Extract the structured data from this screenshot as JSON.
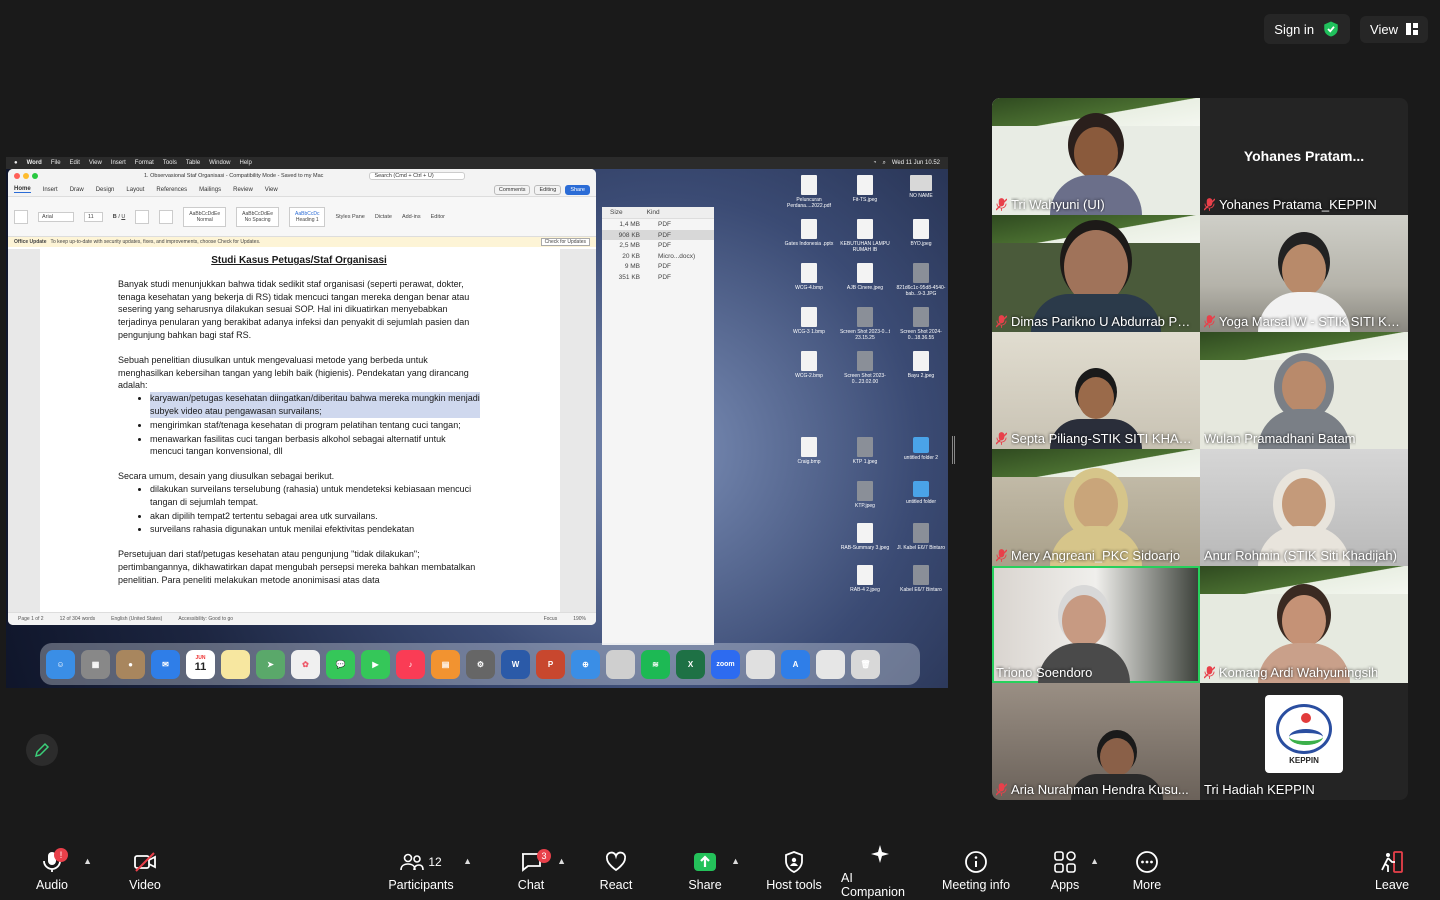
{
  "top_bar": {
    "sign_in": "Sign in",
    "view": "View"
  },
  "shared_screen": {
    "mac_menubar": {
      "app": "Word",
      "menus": [
        "File",
        "Edit",
        "View",
        "Insert",
        "Format",
        "Tools",
        "Table",
        "Window",
        "Help"
      ],
      "datetime": "Wed 11 Jun 10.52"
    },
    "word": {
      "title": "1. Observasional Staf Organisasi - Compatibility Mode - Saved to my Mac",
      "search_placeholder": "Search (Cmd + Ctrl + U)",
      "tabs": [
        "Home",
        "Insert",
        "Draw",
        "Design",
        "Layout",
        "References",
        "Mailings",
        "Review",
        "View"
      ],
      "comments": "Comments",
      "editing": "Editing",
      "share": "Share",
      "font": "Arial",
      "font_size": "11",
      "styles": [
        "Normal",
        "No Spacing",
        "Heading 1"
      ],
      "ribbon_right": [
        "Styles Pane",
        "Dictate",
        "Add-ins",
        "Editor"
      ],
      "update_label": "Office Update",
      "update_text": "To keep up-to-date with security updates, fixes, and improvements, choose Check for Updates.",
      "update_btn": "Check for Updates",
      "doc": {
        "heading": "Studi Kasus Petugas/Staf Organisasi",
        "p1": "Banyak studi menunjukkan bahwa tidak sedikit staf organisasi (seperti perawat, dokter, tenaga kesehatan yang bekerja di RS) tidak mencuci tangan mereka dengan benar atau sesering yang seharusnya dilakukan sesuai SOP. Hal ini dikuatirkan menyebabkan terjadinya penularan yang berakibat adanya infeksi dan penyakit di sejumlah pasien dan pengunjung bahkan bagi staf RS.",
        "p2": "Sebuah penelitian diusulkan untuk mengevaluasi metode yang berbeda untuk menghasilkan kebersihan tangan yang lebih baik (higienis). Pendekatan yang dirancang adalah:",
        "list1": [
          "karyawan/petugas kesehatan diingatkan/diberitau bahwa mereka mungkin menjadi subyek video atau pengawasan survailans;",
          "mengirimkan staf/tenaga kesehatan di program pelatihan tentang cuci tangan;",
          "menawarkan fasilitas cuci tangan berbasis alkohol sebagai alternatif untuk mencuci tangan konvensional, dll"
        ],
        "p3": "Secara umum, desain yang diusulkan sebagai berikut.",
        "list2": [
          "dilakukan surveilans terselubung (rahasia) untuk mendeteksi kebiasaan mencuci tangan di sejumlah tempat.",
          "akan dipilih tempat2 tertentu sebagai area utk survailans.",
          "surveilans rahasia digunakan untuk menilai efektivitas pendekatan"
        ],
        "p4": "Persetujuan dari staf/petugas kesehatan atau pengunjung \"tidak dilakukan\"; pertimbangannya, dikhawatirkan dapat mengubah persepsi mereka bahkan membatalkan penelitian. Para peneliti melakukan metode anonimisasi atas data"
      },
      "status": {
        "page": "Page 1 of 2",
        "words": "12 of 304 words",
        "lang": "English (United States)",
        "access": "Accessibility: Good to go",
        "focus": "Focus",
        "zoom": "190%"
      }
    },
    "finder": {
      "search_placeholder": "Search",
      "headers": [
        "Size",
        "Kind"
      ],
      "rows": [
        {
          "size": "1,4 MB",
          "kind": "PDF"
        },
        {
          "size": "908 KB",
          "kind": "PDF"
        },
        {
          "size": "2,5 MB",
          "kind": "PDF"
        },
        {
          "size": "20 KB",
          "kind": "Micro...docx)"
        },
        {
          "size": "9 MB",
          "kind": "PDF"
        },
        {
          "size": "351 KB",
          "kind": "PDF"
        }
      ]
    },
    "desktop_icons": [
      "Peluncuran Perdana....2022.pdf",
      "Fit-TS.jpeg",
      "NO NAME",
      "Gates Indonesia .pptx",
      "KEBUTUHAN LAMPU RUMAH IB",
      "BYD.jpeg",
      "WCG-4.bmp",
      "AJB Cinere.jpeg",
      "821d6c1c-95d8-4540-bab...9-3.JPG",
      "WCG-3 1.bmp",
      "Screen Shot 2023-0...t 23.15.25",
      "Screen Shot 2024-0...18.36.55",
      "WCG-2.bmp",
      "Screen Shot 2023-0...23.02.00",
      "Bayu 2.jpeg",
      "Craig.bmp",
      "KTP 1.jpeg",
      "untitled folder 2",
      "KTP.jpeg",
      "untitled folder",
      "RAB-Summary 3.jpeg",
      "Jl. Kabel E6/7 Bintaro",
      "RAB-4 2.jpeg",
      "Kabel E6/7 Bintaro"
    ],
    "dock_calendar": {
      "month": "JUN",
      "day": "11"
    },
    "dock_zoom": "zoom"
  },
  "participants": [
    {
      "name": "Tri Wahyuni (UI)",
      "muted": true
    },
    {
      "name": "Yohanes Pratama_KEPPIN",
      "muted": true,
      "display": "Yohanes  Pratam..."
    },
    {
      "name": "Dimas Parikno U Abdurrab Pe...",
      "muted": true
    },
    {
      "name": "Yoga Marsal W - STIK SITI KH...",
      "muted": true
    },
    {
      "name": "Septa Piliang-STIK SITI KHADI...",
      "muted": true
    },
    {
      "name": "Wulan Pramadhani Batam",
      "muted": false
    },
    {
      "name": "Mery Angreani_PKC Sidoarjo",
      "muted": true
    },
    {
      "name": "Anur Rohmin (STIK Siti Khadijah)",
      "muted": false
    },
    {
      "name": "Triono Soendoro",
      "muted": false
    },
    {
      "name": "Komang Ardi Wahyuningsih",
      "muted": true
    },
    {
      "name": "Aria Nurahman Hendra Kusu...",
      "muted": true
    },
    {
      "name": "Tri Hadiah KEPPIN",
      "muted": false,
      "logo_text": "KEPPIN"
    }
  ],
  "toolbar": {
    "audio": "Audio",
    "audio_badge": "!",
    "video": "Video",
    "participants": "Participants",
    "participants_count": "12",
    "chat": "Chat",
    "chat_badge": "3",
    "react": "React",
    "share": "Share",
    "host_tools": "Host tools",
    "ai_companion": "AI Companion",
    "meeting_info": "Meeting info",
    "apps": "Apps",
    "more": "More",
    "leave": "Leave"
  }
}
